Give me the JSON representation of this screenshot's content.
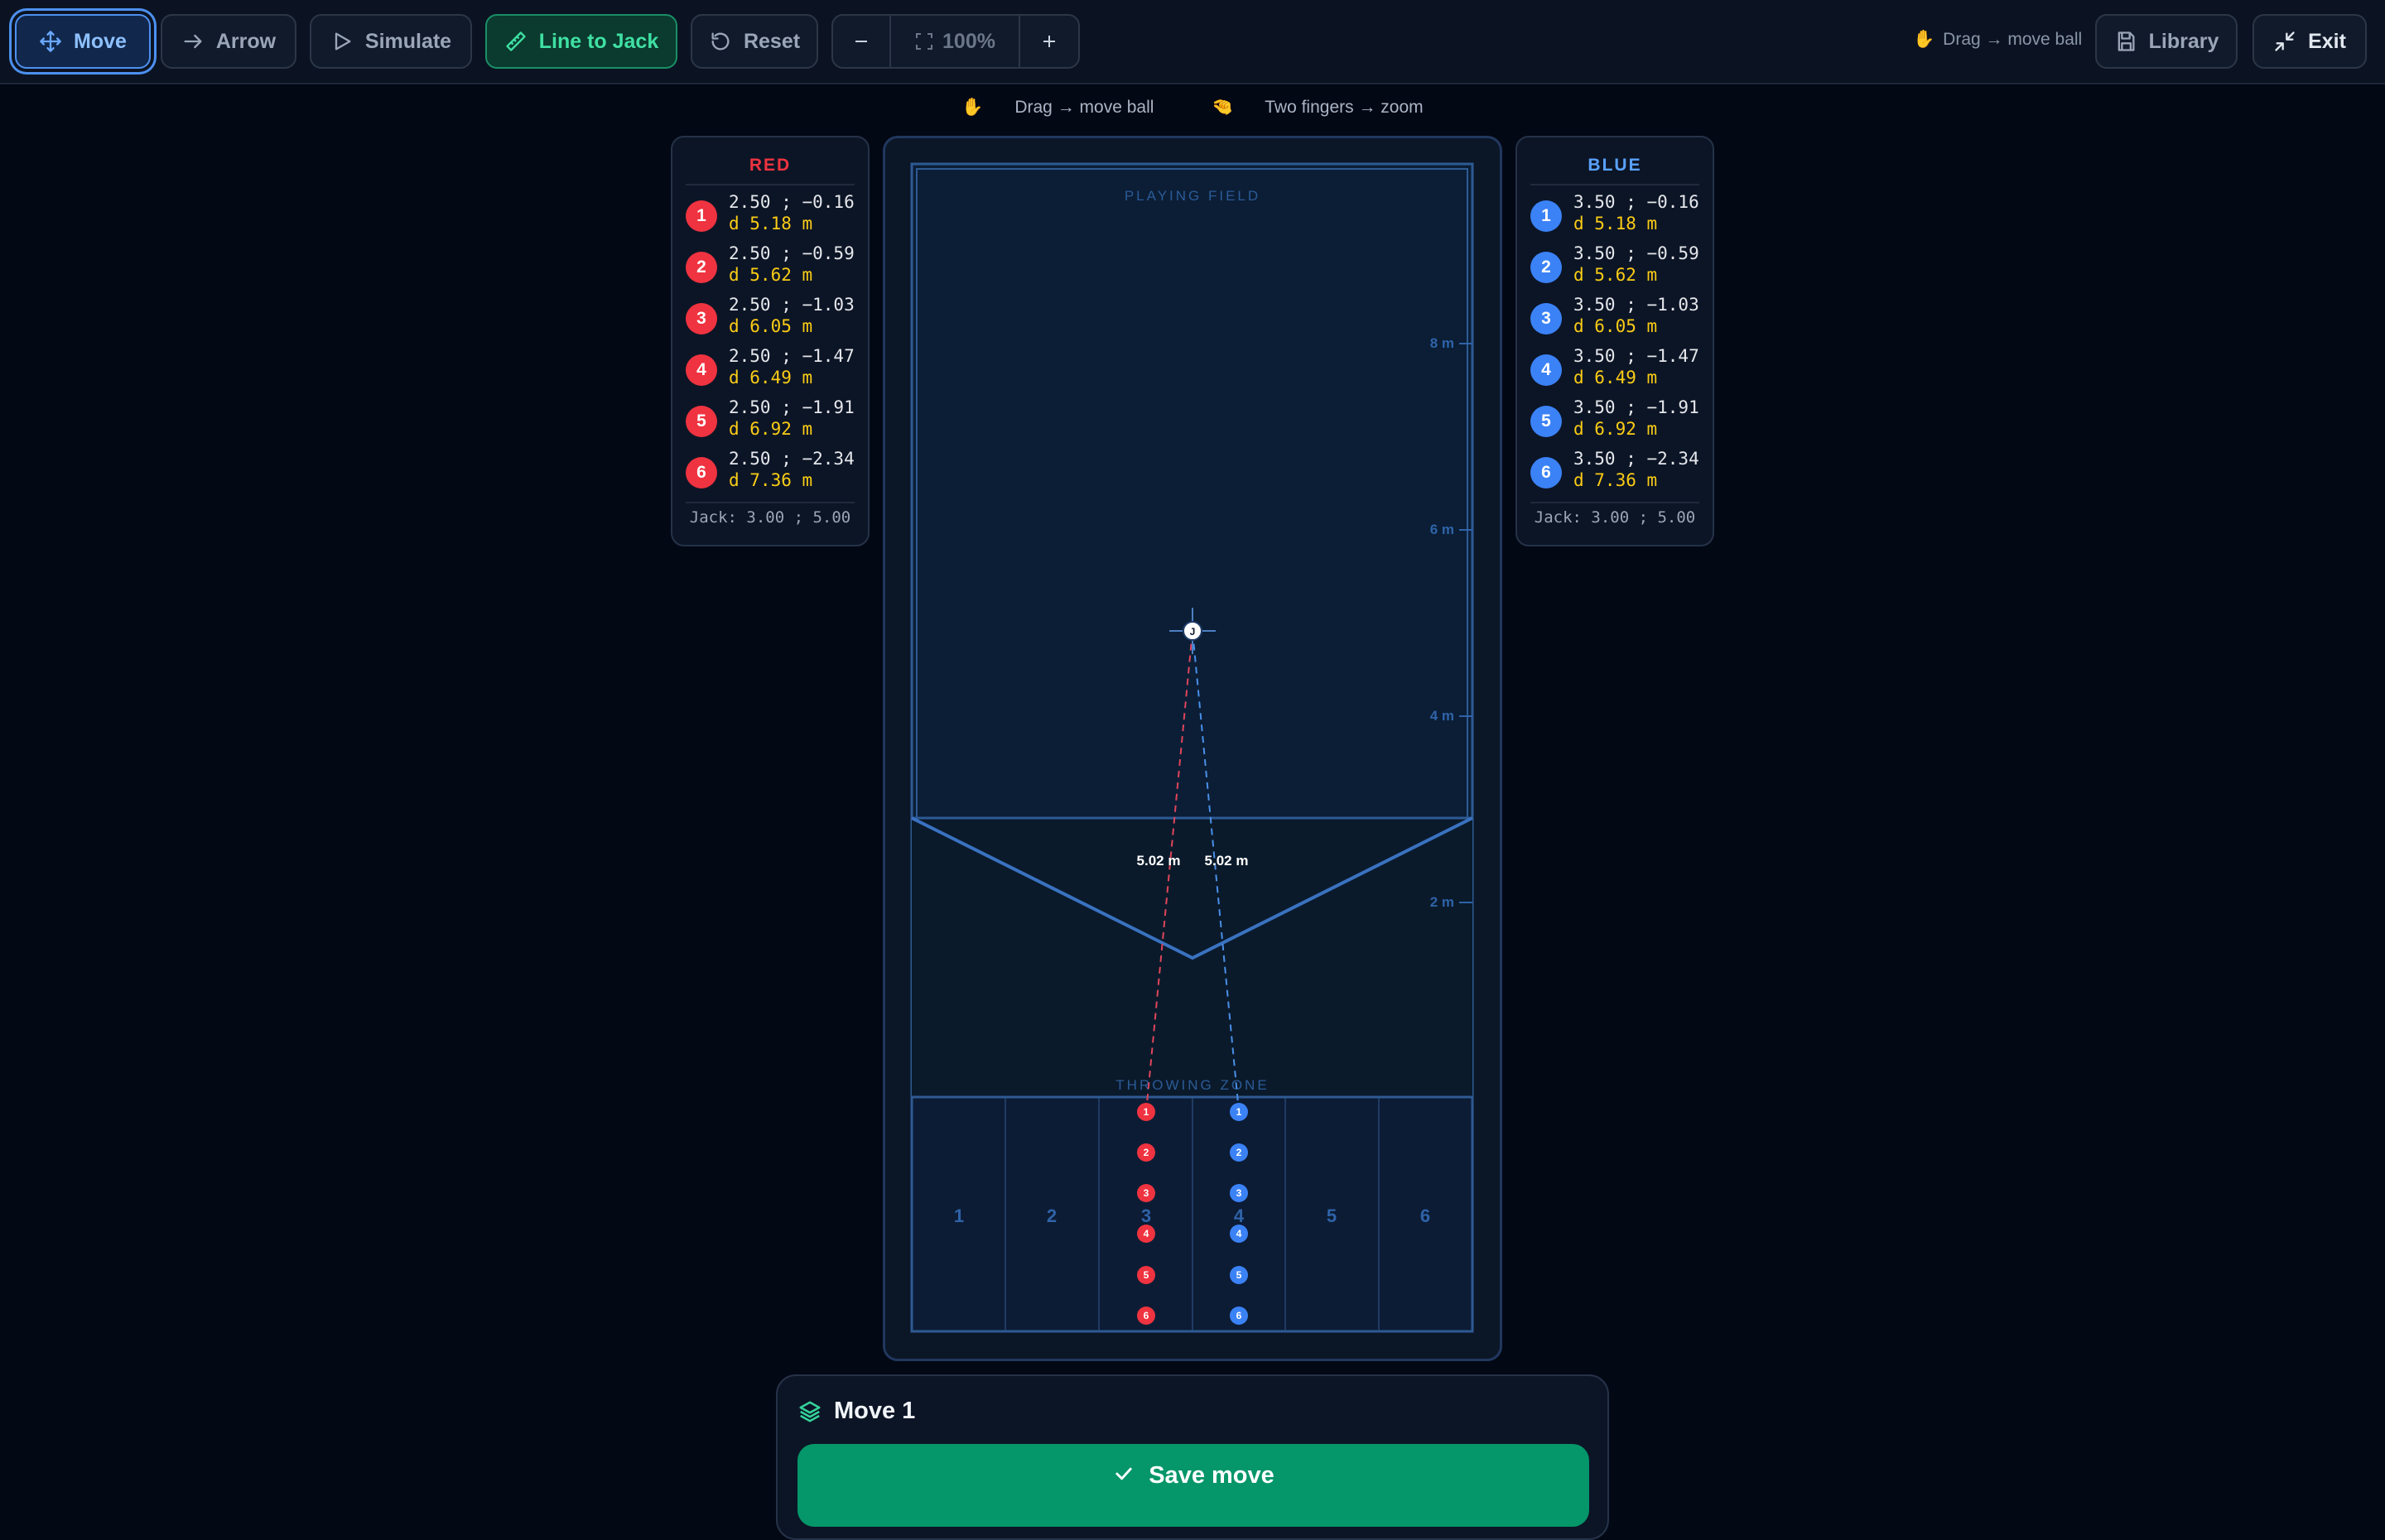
{
  "toolbar": {
    "move_label": "Move",
    "arrow_label": "Arrow",
    "simulate_label": "Simulate",
    "line_label": "Line to Jack",
    "reset_label": "Reset",
    "zoom_value": "100%",
    "drag_hint": "Drag → move ball",
    "library_label": "Library",
    "exit_label": "Exit"
  },
  "hints": {
    "drag": "Drag → move ball",
    "pinch": "Two fingers → zoom"
  },
  "red_panel": {
    "title": "RED",
    "color": "#ef3340",
    "balls": [
      {
        "num": "1",
        "coord": "2.50 ; −0.16",
        "dist": "d 5.18 m"
      },
      {
        "num": "2",
        "coord": "2.50 ; −0.59",
        "dist": "d 5.62 m"
      },
      {
        "num": "3",
        "coord": "2.50 ; −1.03",
        "dist": "d 6.05 m"
      },
      {
        "num": "4",
        "coord": "2.50 ; −1.47",
        "dist": "d 6.49 m"
      },
      {
        "num": "5",
        "coord": "2.50 ; −1.91",
        "dist": "d 6.92 m"
      },
      {
        "num": "6",
        "coord": "2.50 ; −2.34",
        "dist": "d 7.36 m"
      }
    ],
    "jack": "Jack: 3.00 ; 5.00"
  },
  "blue_panel": {
    "title": "BLUE",
    "color": "#3b82f6",
    "balls": [
      {
        "num": "1",
        "coord": "3.50 ; −0.16",
        "dist": "d 5.18 m"
      },
      {
        "num": "2",
        "coord": "3.50 ; −0.59",
        "dist": "d 5.62 m"
      },
      {
        "num": "3",
        "coord": "3.50 ; −1.03",
        "dist": "d 6.05 m"
      },
      {
        "num": "4",
        "coord": "3.50 ; −1.47",
        "dist": "d 6.49 m"
      },
      {
        "num": "5",
        "coord": "3.50 ; −1.91",
        "dist": "d 6.92 m"
      },
      {
        "num": "6",
        "coord": "3.50 ; −2.34",
        "dist": "d 7.36 m"
      }
    ],
    "jack": "Jack: 3.00 ; 5.00"
  },
  "field": {
    "playing_field_label": "PLAYING FIELD",
    "throwing_zone_label": "THROWING ZONE",
    "scale_labels": [
      "8 m",
      "6 m",
      "4 m",
      "2 m"
    ],
    "boxes": [
      "1",
      "2",
      "3",
      "4",
      "5",
      "6"
    ],
    "jack_symbol": "J",
    "red_distance_label": "5.02 m",
    "blue_distance_label": "5.02 m",
    "red_balls": [
      "1",
      "2",
      "3",
      "4",
      "5",
      "6"
    ],
    "blue_balls": [
      "1",
      "2",
      "3",
      "4",
      "5",
      "6"
    ]
  },
  "move_card": {
    "title": "Move 1",
    "save_label": "Save move"
  }
}
